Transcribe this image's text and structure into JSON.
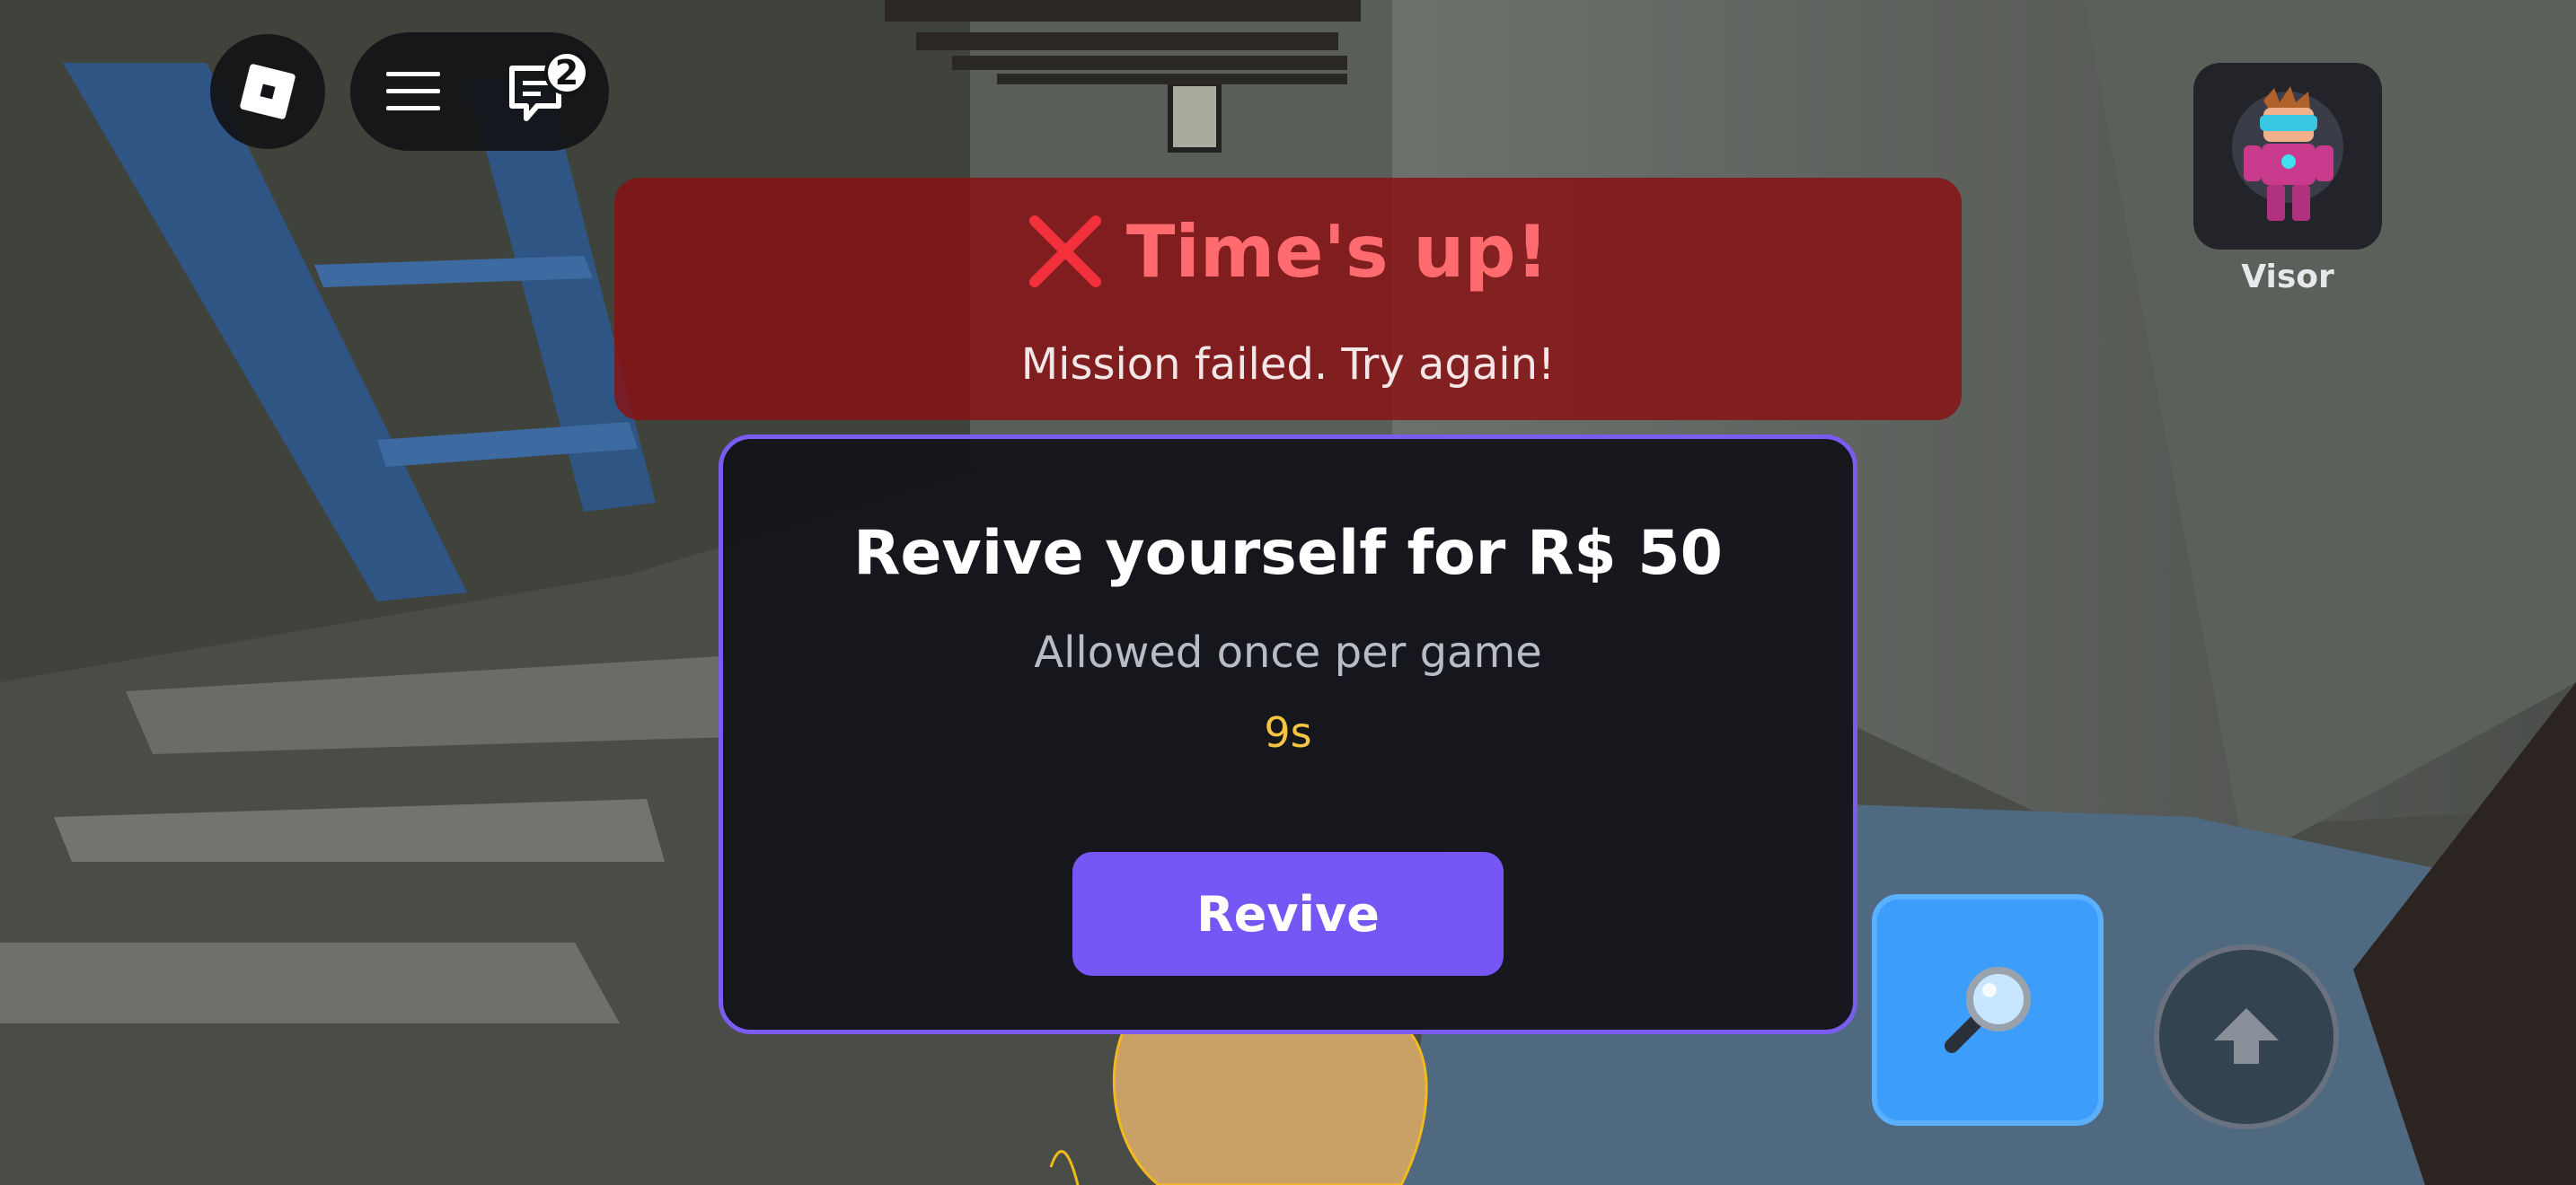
{
  "banner": {
    "title": "Time's up!",
    "subtitle": "Mission failed. Try again!",
    "icon": "x-mark-icon",
    "accent_color": "#ff6b6e"
  },
  "revive_panel": {
    "title": "Revive yourself for R$ 50",
    "subtitle": "Allowed once per game",
    "timer": "9s",
    "button_label": "Revive",
    "border_color": "#7a5cf0",
    "button_color": "#7657f5",
    "timer_color": "#f5c542"
  },
  "hud": {
    "chat_badge_count": "2",
    "icons": [
      "roblox-logo-icon",
      "menu-icon",
      "chat-icon"
    ]
  },
  "avatar": {
    "label": "Visor"
  },
  "controls": {
    "search_icon": "magnifier-icon",
    "jump_icon": "jump-arrow-icon",
    "search_color": "#3d9dfb"
  }
}
